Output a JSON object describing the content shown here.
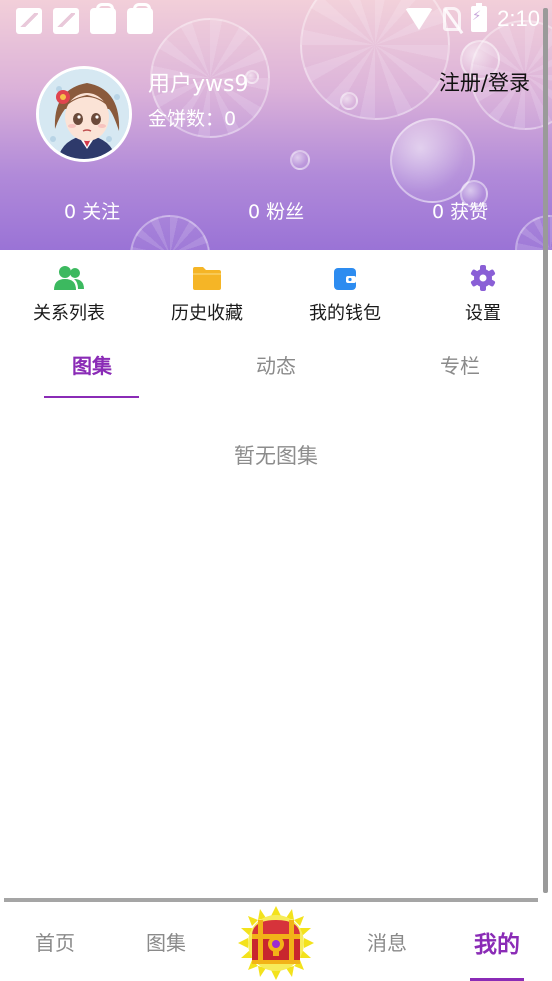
{
  "status_bar": {
    "time": "2:10",
    "icons": [
      "image-icon",
      "image-icon",
      "shopping-bag-icon",
      "shopping-bag-icon",
      "wifi-icon",
      "no-sim-icon",
      "battery-charging-icon"
    ]
  },
  "profile": {
    "username": "用户yws9",
    "coins": "金饼数：0",
    "login_link": "注册/登录"
  },
  "stats": {
    "following": "0 关注",
    "fans": "0 粉丝",
    "likes": "0 获赞"
  },
  "quick_menu": [
    {
      "label": "关系列表",
      "icon": "people-icon",
      "color": "#3cb95f"
    },
    {
      "label": "历史收藏",
      "icon": "folder-icon",
      "color": "#f5b526"
    },
    {
      "label": "我的钱包",
      "icon": "wallet-icon",
      "color": "#2d8cf0"
    },
    {
      "label": "设置",
      "icon": "gear-icon",
      "color": "#8a5fd6"
    }
  ],
  "tabs": [
    {
      "label": "图集",
      "active": true
    },
    {
      "label": "动态",
      "active": false
    },
    {
      "label": "专栏",
      "active": false
    }
  ],
  "empty_text": "暂无图集",
  "bottom_nav": [
    {
      "label": "首页",
      "active": false
    },
    {
      "label": "图集",
      "active": false
    },
    {
      "label": "",
      "icon": "treasure-chest-icon"
    },
    {
      "label": "消息",
      "active": false
    },
    {
      "label": "我的",
      "active": true
    }
  ],
  "colors": {
    "accent": "#8a2bb6",
    "header_gradient_top": "#f2cfd9",
    "header_gradient_bottom": "#9a73d6"
  }
}
